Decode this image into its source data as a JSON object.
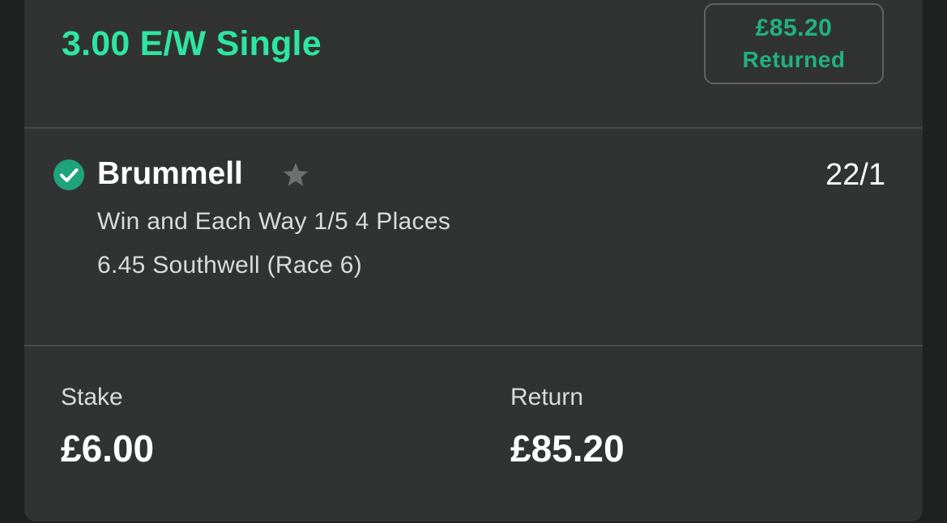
{
  "bet": {
    "title": "3.00 E/W Single",
    "returned_amount": "£85.20",
    "returned_label": "Returned"
  },
  "selection": {
    "status_icon": "check-circle-icon",
    "name": "Brummell",
    "favourite_icon": "star-icon",
    "odds": "22/1",
    "market": "Win and Each Way 1/5 4 Places",
    "race": "6.45 Southwell (Race 6)"
  },
  "summary": {
    "stake_label": "Stake",
    "stake_value": "£6.00",
    "return_label": "Return",
    "return_value": "£85.20"
  },
  "colors": {
    "accent": "#2ee5a3",
    "returned": "#21b27f",
    "card_bg": "#303332",
    "page_bg": "#1f2120",
    "check_bg": "#1fa37a",
    "star": "#6d716f"
  }
}
